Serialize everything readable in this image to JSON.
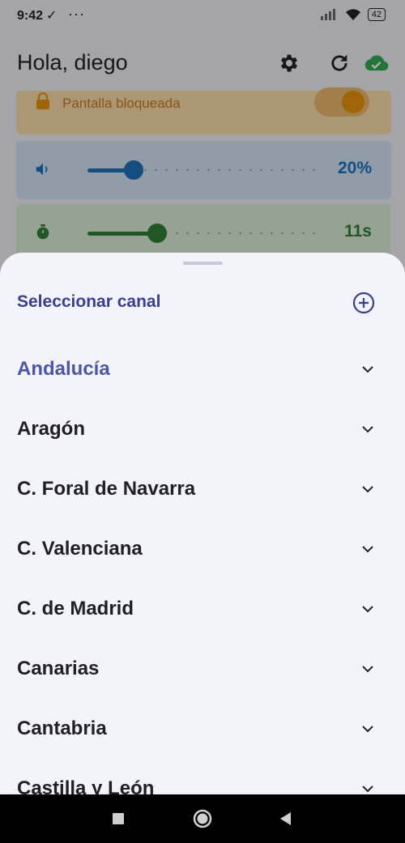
{
  "status_bar": {
    "time": "9:42",
    "check": "✓",
    "dots": "···",
    "battery": "42"
  },
  "app_bar": {
    "greeting": "Hola, diego"
  },
  "cards": {
    "lock": {
      "label": "Pantalla bloqueada",
      "toggle_on": true
    },
    "volume": {
      "value": "20%",
      "level": 0.2
    },
    "timer": {
      "value": "11s",
      "level": 0.3
    }
  },
  "sheet": {
    "title": "Seleccionar canal",
    "regions": [
      {
        "label": "Andalucía",
        "active": true
      },
      {
        "label": "Aragón",
        "active": false
      },
      {
        "label": "C. Foral de Navarra",
        "active": false
      },
      {
        "label": "C. Valenciana",
        "active": false
      },
      {
        "label": "C. de Madrid",
        "active": false
      },
      {
        "label": "Canarias",
        "active": false
      },
      {
        "label": "Cantabria",
        "active": false
      },
      {
        "label": "Castilla y León",
        "active": false
      }
    ]
  },
  "colors": {
    "accent": "#39418f",
    "active_region": "#4b57a4",
    "volume": "#1e6fb8",
    "timer": "#2e7d32",
    "lock": "#e6900e",
    "sync_ok": "#34a853"
  }
}
